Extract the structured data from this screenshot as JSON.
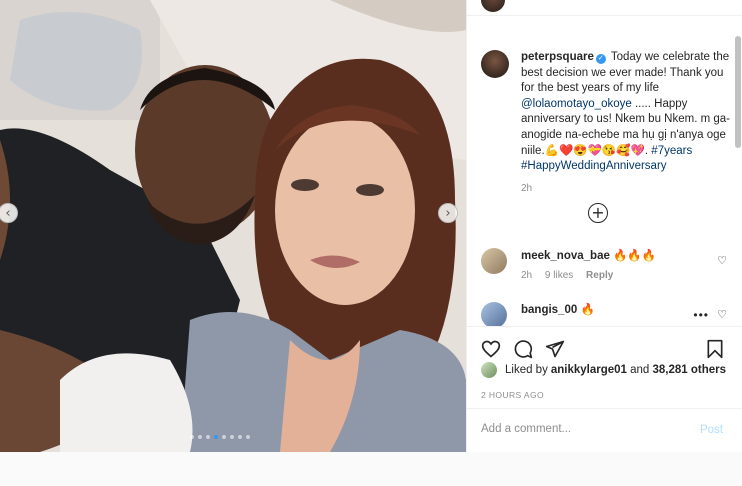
{
  "post": {
    "author": "peterpsquare",
    "caption": {
      "username": "peterpsquare",
      "text_1": " Today we celebrate the best decision we ever made! Thank you for the best years of my life ",
      "mention": "@lolaomotayo_okoye",
      "text_2": " ..... Happy anniversary to us! Nkem bu Nkem. m ga-anogide na-echebe ma hụ gị n'anya oge niile.",
      "emojis": "💪❤️😍💝😘🥰💖.",
      "hashtags": "#7years #HappyWeddingAnniversary",
      "time": "2h"
    },
    "comments": [
      {
        "username": "meek_nova_bae",
        "text": "🔥🔥🔥",
        "time": "2h",
        "likes": "9 likes",
        "reply_label": "Reply"
      },
      {
        "username": "bangis_00",
        "text": "🔥"
      }
    ],
    "liked_by": {
      "prefix": "Liked by ",
      "user": "anikkylarge01",
      "middle": " and ",
      "others": "38,281 others"
    },
    "timestamp": "2 HOURS AGO",
    "comment_input": {
      "placeholder": "Add a comment...",
      "value": ""
    },
    "post_button": "Post",
    "carousel": {
      "total": 8,
      "active_index": 3
    }
  },
  "colors": {
    "link": "#00376b",
    "verified": "#3897f0",
    "muted": "#8e8e8e",
    "post_disabled": "#b2dffc"
  },
  "icons": {
    "like": "heart-icon",
    "comment": "comment-icon",
    "share": "share-icon",
    "save": "bookmark-icon",
    "add": "plus-circle-icon",
    "prev": "chevron-left-icon",
    "next": "chevron-right-icon"
  }
}
